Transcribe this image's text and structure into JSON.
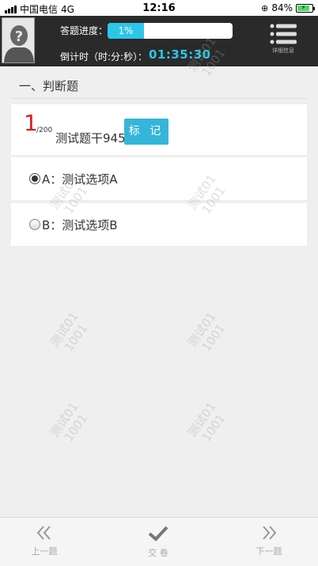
{
  "status_bar": {
    "carrier": "中国电信",
    "network": "4G",
    "time": "12:16",
    "battery_percent": "84%"
  },
  "header": {
    "progress_label": "答题进度：",
    "progress_value": "1%",
    "progress_fraction": 0.01,
    "timer_label": "倒计时（时:分:秒）：",
    "timer_value": "01:35:30",
    "details_label": "详细信息",
    "accent_color": "#2ec6e8"
  },
  "section": {
    "title": "一、判断题"
  },
  "question": {
    "number": "1",
    "total": "/200",
    "text": "测试题干945",
    "mark_label": "标 记"
  },
  "options": [
    {
      "label": "A：测试选项A",
      "selected": true
    },
    {
      "label": "B：测试选项B",
      "selected": false
    }
  ],
  "watermark": {
    "line1": "测试01",
    "line2": "1001"
  },
  "bottom_nav": {
    "prev_label": "上一题",
    "submit_label": "交 卷",
    "next_label": "下一题"
  }
}
